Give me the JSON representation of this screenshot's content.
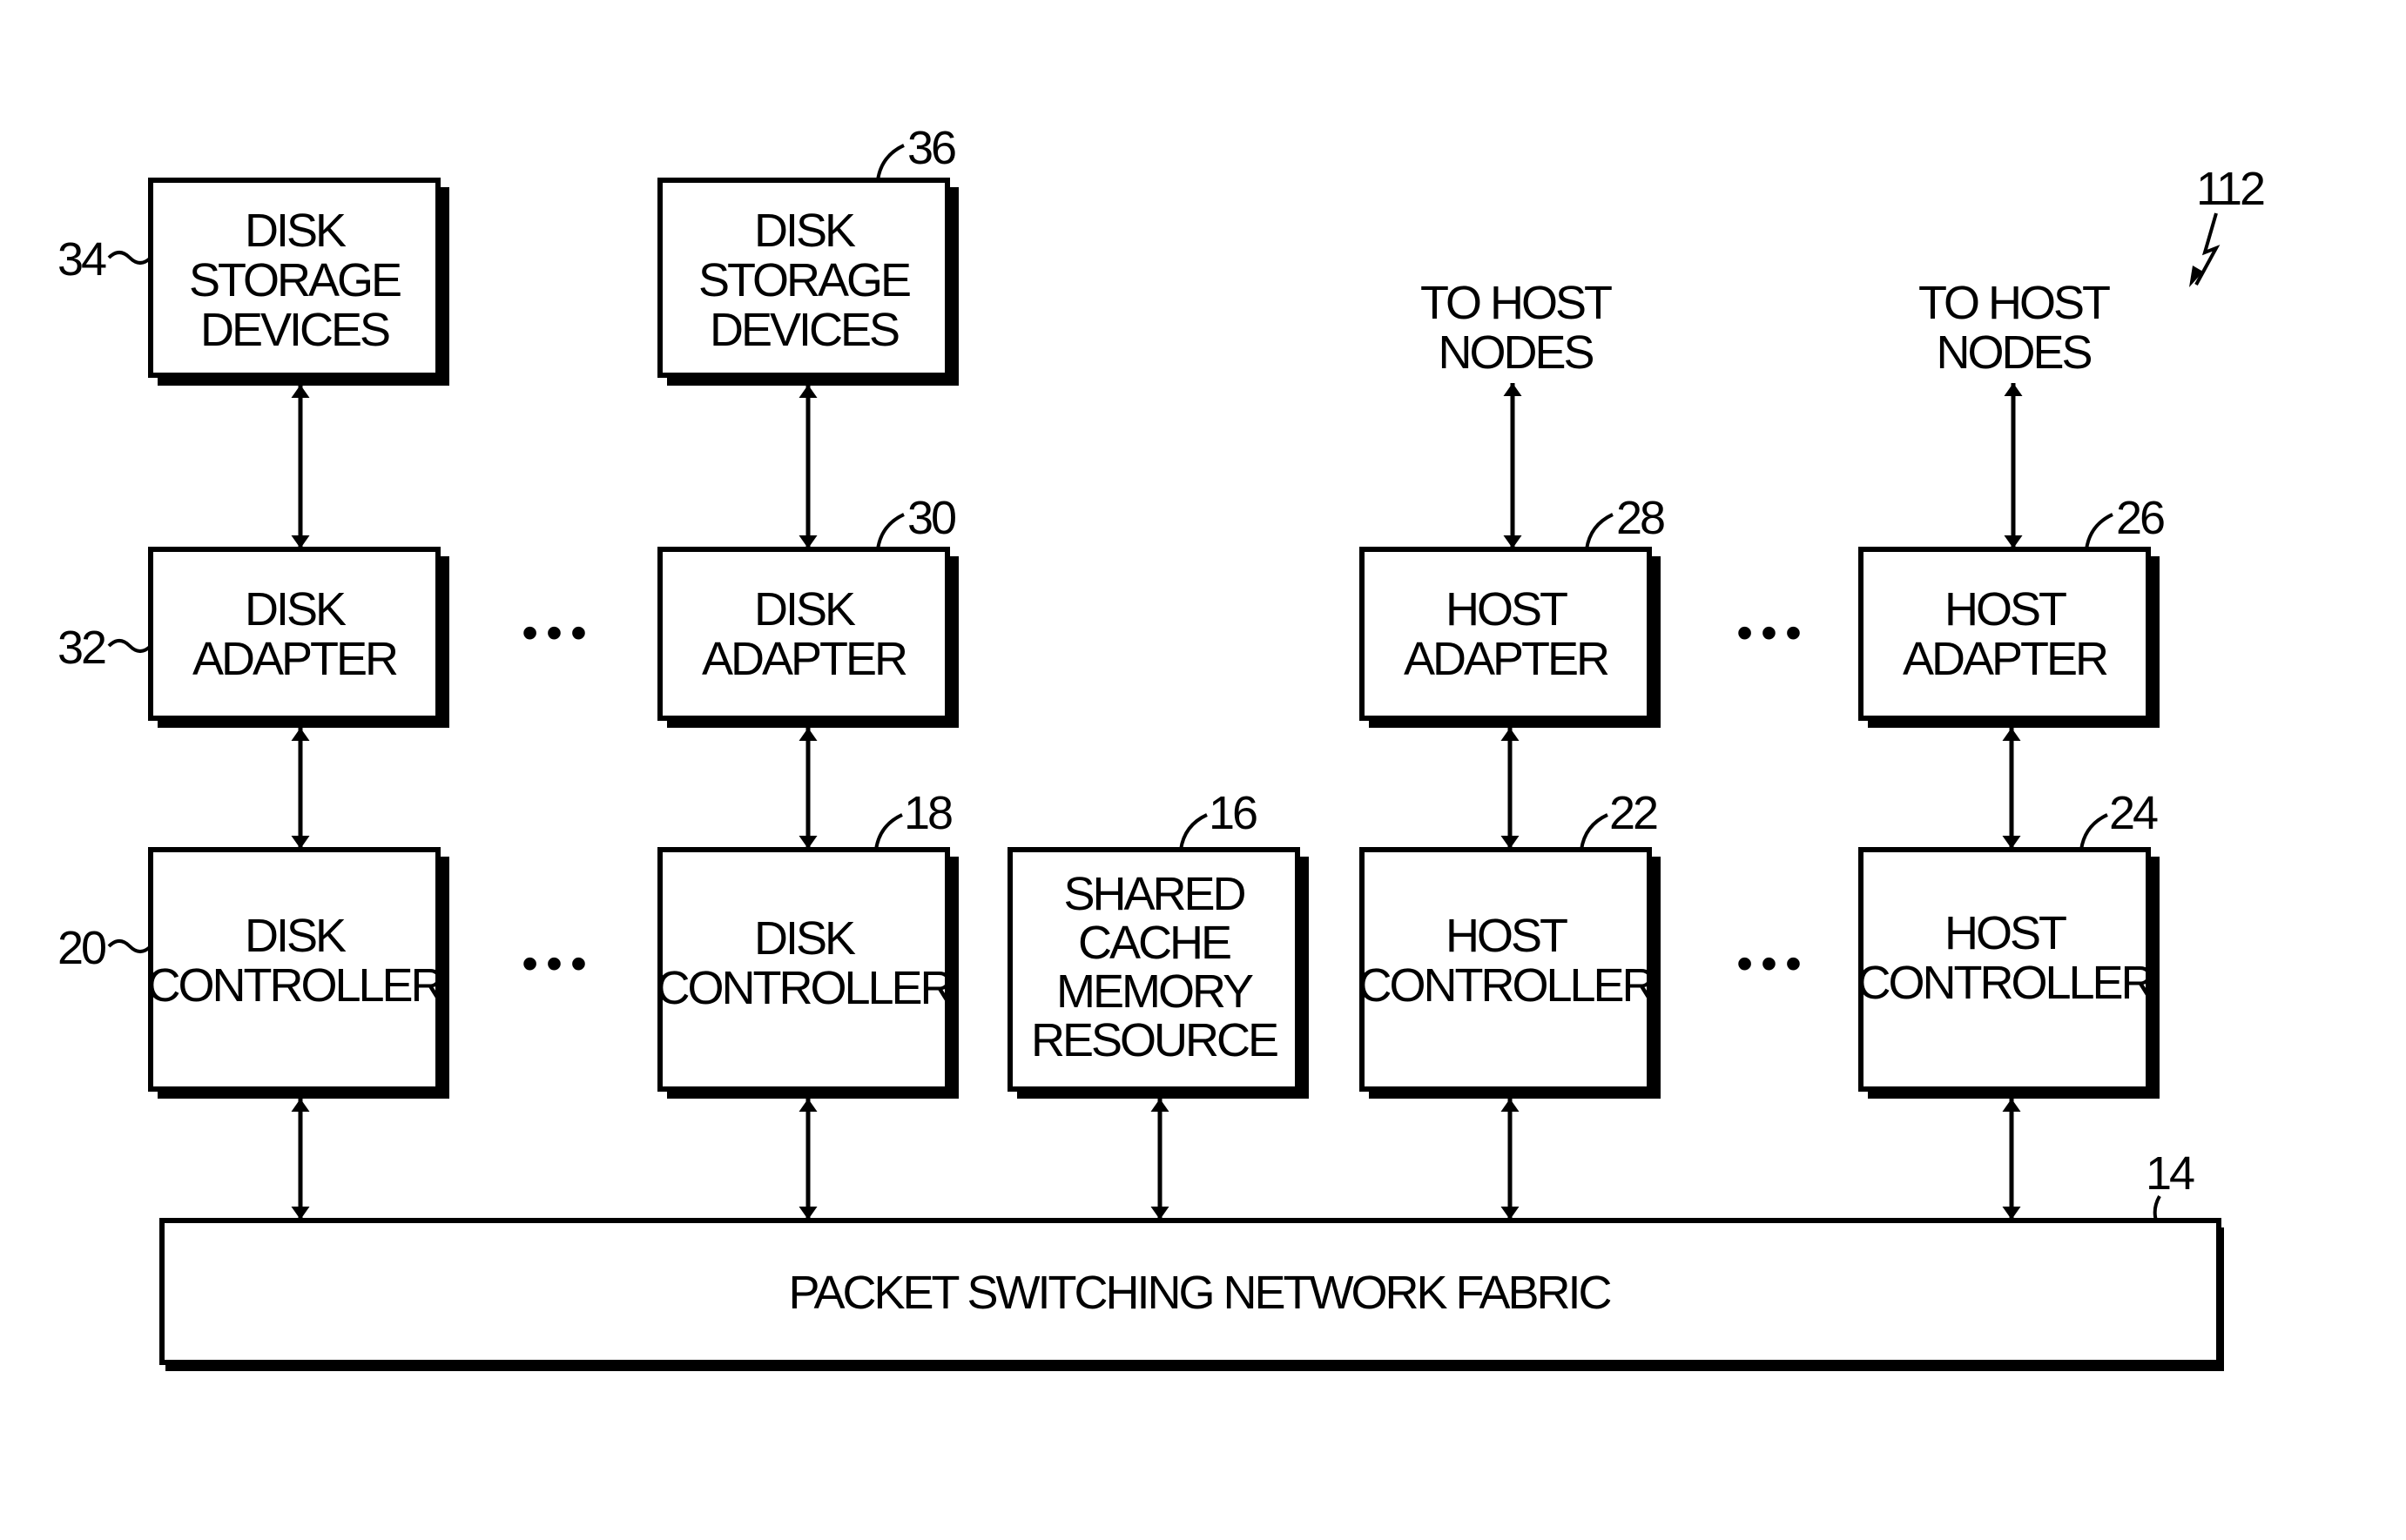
{
  "figure_ref": "112",
  "blocks": {
    "disk_storage_1": {
      "ref": "34",
      "lines": [
        "DISK",
        "STORAGE",
        "DEVICES"
      ]
    },
    "disk_storage_2": {
      "ref": "36",
      "lines": [
        "DISK",
        "STORAGE",
        "DEVICES"
      ]
    },
    "disk_adapter_1": {
      "ref": "32",
      "lines": [
        "DISK",
        "ADAPTER"
      ]
    },
    "disk_adapter_2": {
      "ref": "30",
      "lines": [
        "DISK",
        "ADAPTER"
      ]
    },
    "disk_controller_1": {
      "ref": "20",
      "lines": [
        "DISK",
        "CONTROLLER"
      ]
    },
    "disk_controller_2": {
      "ref": "18",
      "lines": [
        "DISK",
        "CONTROLLER"
      ]
    },
    "shared_cache": {
      "ref": "16",
      "lines": [
        "SHARED",
        "CACHE",
        "MEMORY",
        "RESOURCE"
      ]
    },
    "host_adapter_1": {
      "ref": "28",
      "lines": [
        "HOST",
        "ADAPTER"
      ]
    },
    "host_adapter_2": {
      "ref": "26",
      "lines": [
        "HOST",
        "ADAPTER"
      ]
    },
    "host_controller_1": {
      "ref": "22",
      "lines": [
        "HOST",
        "CONTROLLER"
      ]
    },
    "host_controller_2": {
      "ref": "24",
      "lines": [
        "HOST",
        "CONTROLLER"
      ]
    },
    "fabric": {
      "ref": "14",
      "label": "PACKET SWITCHING NETWORK FABRIC"
    }
  },
  "external": {
    "host_nodes_1": [
      "TO HOST",
      "NODES"
    ],
    "host_nodes_2": [
      "TO HOST",
      "NODES"
    ]
  },
  "ellipsis": "• • •"
}
